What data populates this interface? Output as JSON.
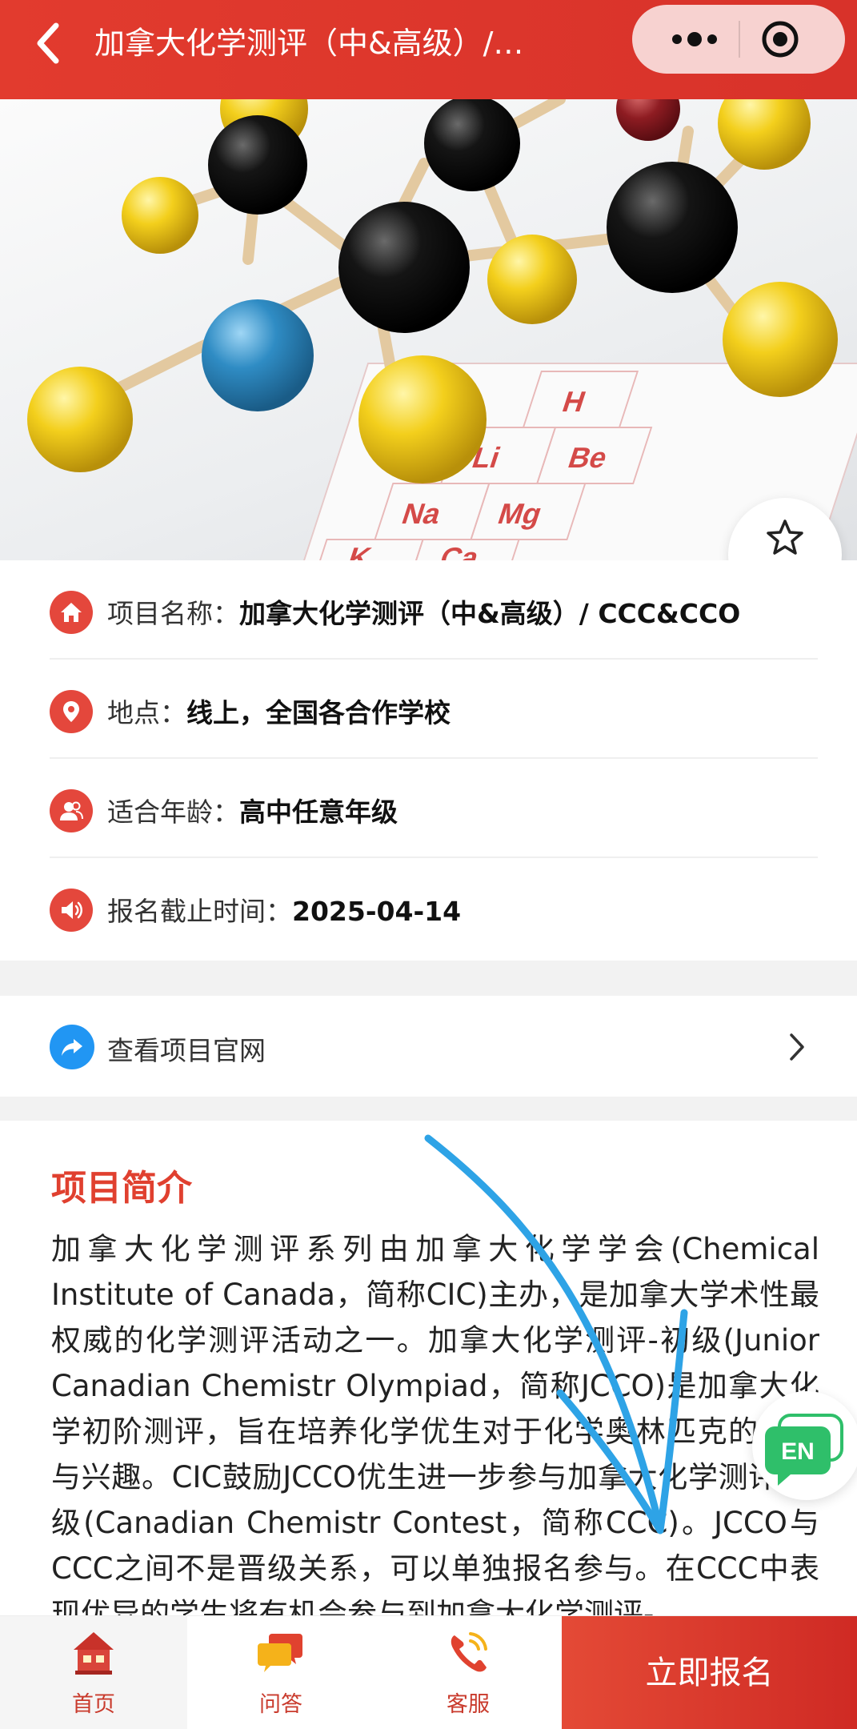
{
  "header": {
    "title": "加拿大化学测评（中&高级）/…"
  },
  "favorite": {
    "label": "收藏"
  },
  "info": {
    "name_label": "项目名称：",
    "name_value": "加拿大化学测评（中&高级）/ CCC&CCO",
    "location_label": "地点：",
    "location_value": "线上，全国各合作学校",
    "age_label": "适合年龄：",
    "age_value": "高中任意年级",
    "deadline_label": "报名截止时间：",
    "deadline_value": "2025-04-14"
  },
  "website": {
    "label": "查看项目官网"
  },
  "intro": {
    "heading": "项目简介",
    "text": "加拿大化学测评系列由加拿大化学学会(Chemical Institute of Canada，简称CIC)主办，是加拿大学术性最权威的化学测评活动之一。加拿大化学测评-初级(Junior Canadian Chemistr Olympiad，简称JCCO)是加拿大化学初阶测评，旨在培养化学优生对于化学奥林匹克的认知与兴趣。CIC鼓励JCCO优生进一步参与加拿大化学测评-中级(Canadian Chemistr Contest，简称CCC)。JCCO与CCC之间不是晋级关系，可以单独报名参与。在CCC中表现优异的学生将有机会参与到加拿大化学测评-"
  },
  "lang_button": {
    "label": "EN"
  },
  "tabbar": {
    "home": "首页",
    "qa": "问答",
    "service": "客服",
    "signup": "立即报名"
  },
  "periodic_tiles": [
    "H",
    "Li",
    "Be",
    "Na",
    "Mg",
    "K",
    "Ca"
  ],
  "colors": {
    "brand_red": "#e23b2e",
    "icon_red": "#e4473c",
    "link_blue": "#2196f3",
    "annotation_blue": "#2ea3e6"
  }
}
